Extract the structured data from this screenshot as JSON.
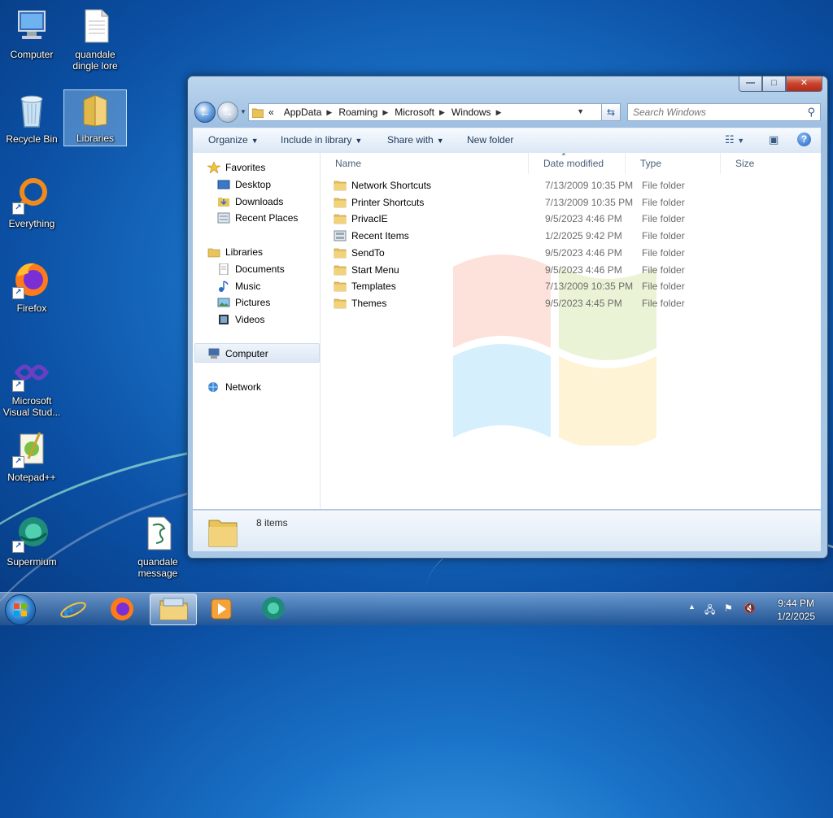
{
  "desktop": {
    "icons": [
      {
        "label": "Computer"
      },
      {
        "label": "quandale dingle lore"
      },
      {
        "label": "Recycle Bin"
      },
      {
        "label": "Libraries"
      },
      {
        "label": "Everything"
      },
      {
        "label": "Firefox"
      },
      {
        "label": "Microsoft Visual Stud..."
      },
      {
        "label": "Notepad++"
      },
      {
        "label": "Supermium"
      },
      {
        "label": "quandale message"
      }
    ]
  },
  "window": {
    "caption": {
      "minimize": "—",
      "maximize": "□",
      "close": "✕"
    },
    "address": {
      "overflow": "«",
      "crumbs": [
        "AppData",
        "Roaming",
        "Microsoft",
        "Windows"
      ]
    },
    "search_placeholder": "Search Windows",
    "toolbar": {
      "organize": "Organize",
      "include": "Include in library",
      "share": "Share with",
      "new_folder": "New folder"
    },
    "nav": {
      "favorites": "Favorites",
      "desktop": "Desktop",
      "downloads": "Downloads",
      "recent_places": "Recent Places",
      "libraries": "Libraries",
      "documents": "Documents",
      "music": "Music",
      "pictures": "Pictures",
      "videos": "Videos",
      "computer": "Computer",
      "network": "Network"
    },
    "columns": {
      "name": "Name",
      "date": "Date modified",
      "type": "Type",
      "size": "Size"
    },
    "files": [
      {
        "name": "Network Shortcuts",
        "date": "7/13/2009 10:35 PM",
        "type": "File folder",
        "icon": "folder-icon"
      },
      {
        "name": "Printer Shortcuts",
        "date": "7/13/2009 10:35 PM",
        "type": "File folder",
        "icon": "folder-icon"
      },
      {
        "name": "PrivacIE",
        "date": "9/5/2023 4:46 PM",
        "type": "File folder",
        "icon": "folder-icon"
      },
      {
        "name": "Recent Items",
        "date": "1/2/2025 9:42 PM",
        "type": "File folder",
        "icon": "recent-items-icon"
      },
      {
        "name": "SendTo",
        "date": "9/5/2023 4:46 PM",
        "type": "File folder",
        "icon": "folder-icon"
      },
      {
        "name": "Start Menu",
        "date": "9/5/2023 4:46 PM",
        "type": "File folder",
        "icon": "folder-icon"
      },
      {
        "name": "Templates",
        "date": "7/13/2009 10:35 PM",
        "type": "File folder",
        "icon": "folder-icon"
      },
      {
        "name": "Themes",
        "date": "9/5/2023 4:45 PM",
        "type": "File folder",
        "icon": "folder-icon"
      }
    ],
    "status": {
      "count": "8 items"
    }
  },
  "taskbar": {
    "clock": {
      "time": "9:44 PM",
      "date": "1/2/2025"
    }
  },
  "colors": {
    "folder": "#e8c45a",
    "selection": "#cde3f7",
    "window_frame": "#a9c8e6"
  }
}
